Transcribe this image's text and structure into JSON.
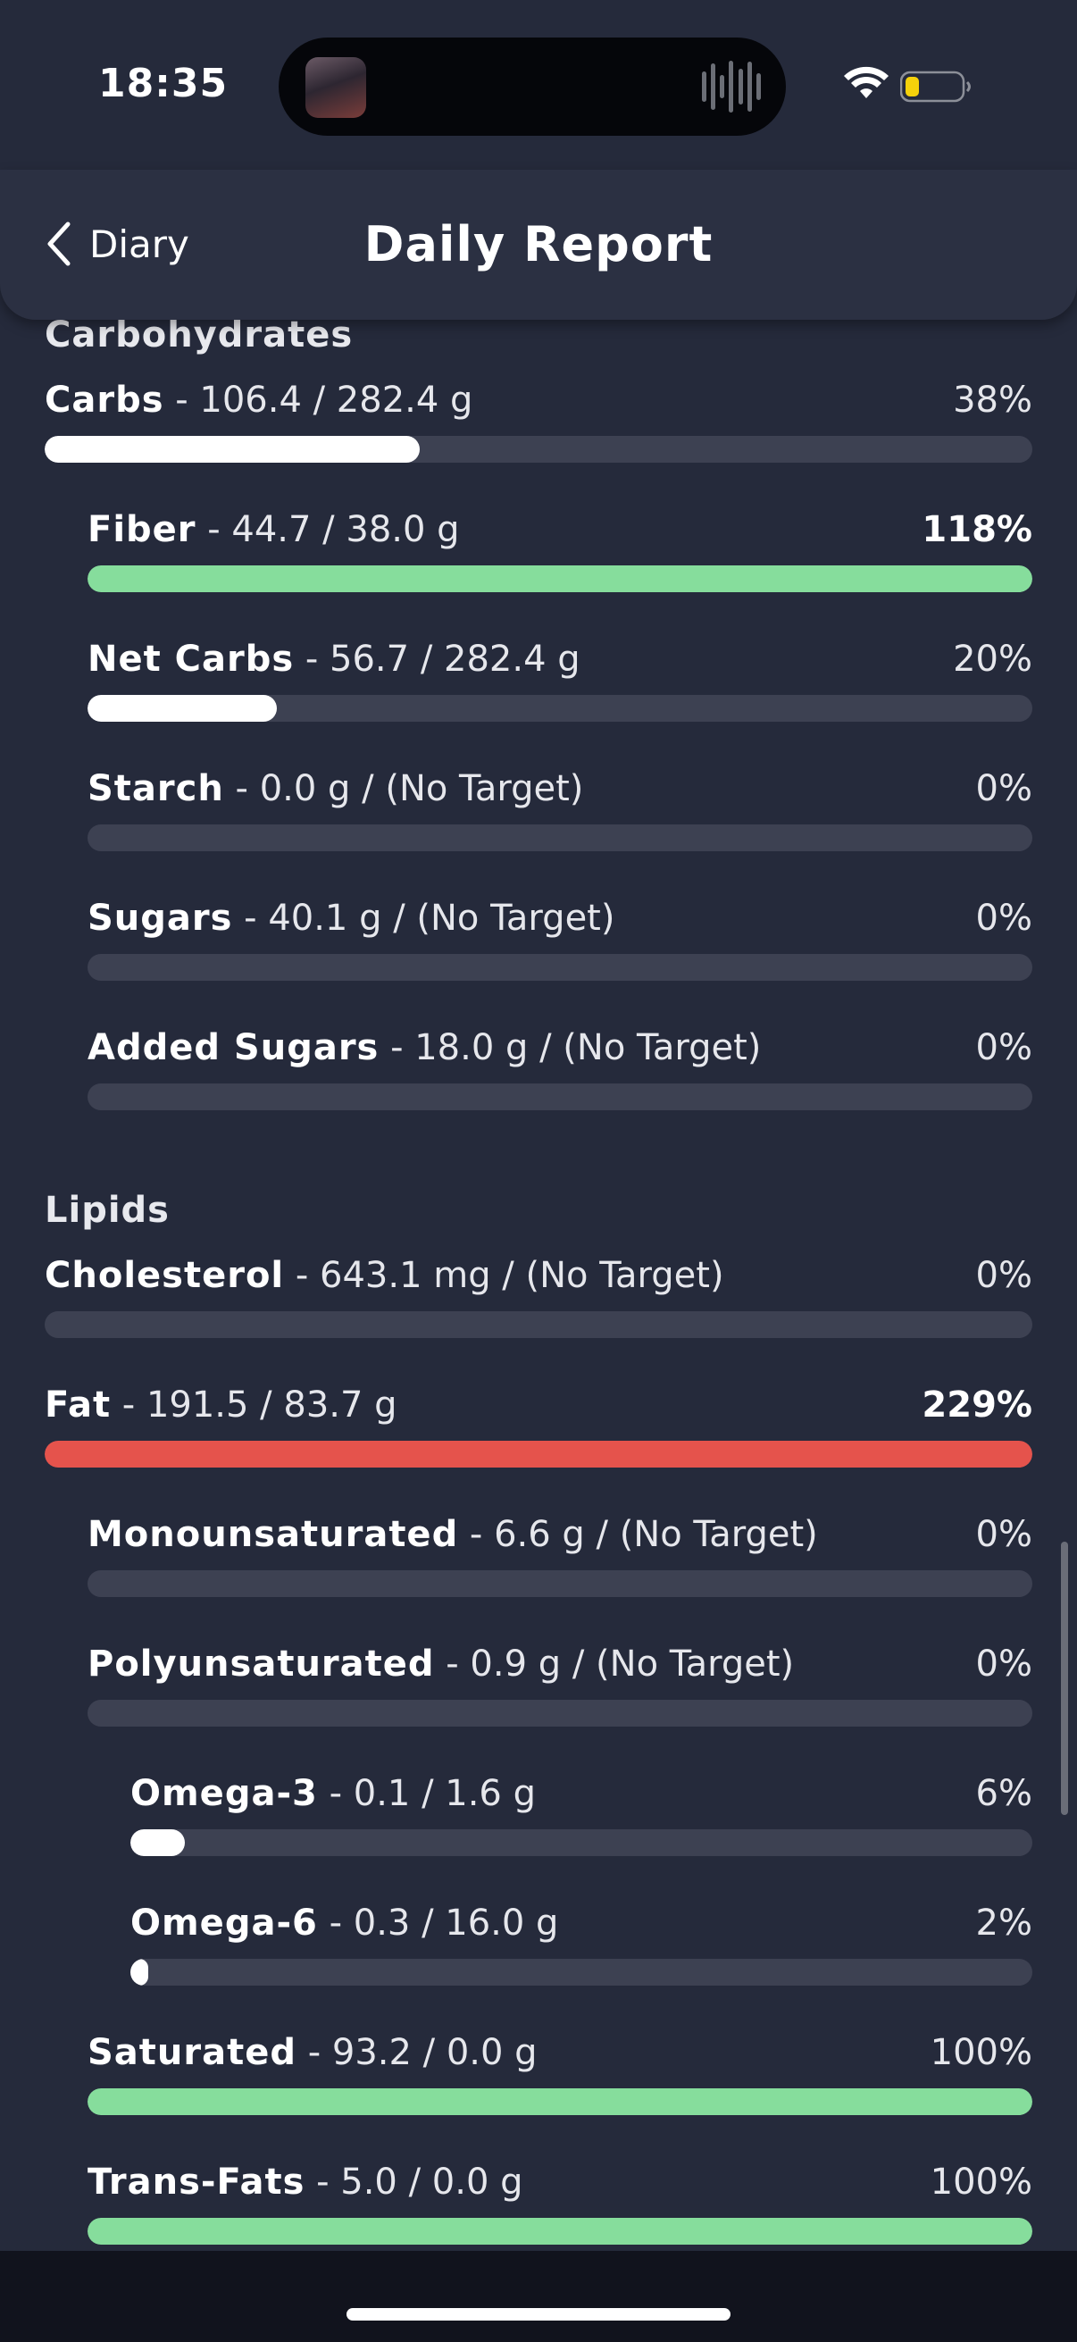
{
  "status_bar": {
    "time": "18:35",
    "battery_level": 0.25,
    "battery_color": "#f5d10b"
  },
  "header": {
    "back_label": "Diary",
    "title": "Daily Report"
  },
  "colors": {
    "background": "#252a3b",
    "track": "#3d4152",
    "fill_default": "#ffffff",
    "fill_good": "#86dd9c",
    "fill_over": "#e5534c"
  },
  "sections": [
    {
      "title": "Carbohydrates",
      "rows": [
        {
          "name": "Carbs",
          "detail": " - 106.4 / 282.4 g",
          "percent": "38%",
          "fill": 0.38,
          "status": "default",
          "level": 0,
          "bold_pct": false
        },
        {
          "name": "Fiber",
          "detail": " - 44.7 / 38.0 g",
          "percent": "118%",
          "fill": 1.0,
          "status": "good",
          "level": 1,
          "bold_pct": true
        },
        {
          "name": "Net Carbs",
          "detail": " - 56.7 / 282.4 g",
          "percent": "20%",
          "fill": 0.2,
          "status": "default",
          "level": 1,
          "bold_pct": false
        },
        {
          "name": "Starch",
          "detail": " - 0.0 g / (No Target)",
          "percent": "0%",
          "fill": 0,
          "status": "default",
          "level": 1,
          "bold_pct": false
        },
        {
          "name": "Sugars",
          "detail": " - 40.1 g / (No Target)",
          "percent": "0%",
          "fill": 0,
          "status": "default",
          "level": 1,
          "bold_pct": false
        },
        {
          "name": "Added Sugars",
          "detail": " - 18.0 g / (No Target)",
          "percent": "0%",
          "fill": 0,
          "status": "default",
          "level": 1,
          "bold_pct": false
        }
      ]
    },
    {
      "title": "Lipids",
      "rows": [
        {
          "name": "Cholesterol",
          "detail": " - 643.1 mg / (No Target)",
          "percent": "0%",
          "fill": 0,
          "status": "default",
          "level": 0,
          "bold_pct": false
        },
        {
          "name": "Fat",
          "detail": " - 191.5 / 83.7 g",
          "percent": "229%",
          "fill": 1.0,
          "status": "over",
          "level": 0,
          "bold_pct": true
        },
        {
          "name": "Monounsaturated",
          "detail": " - 6.6 g / (No Target)",
          "percent": "0%",
          "fill": 0,
          "status": "default",
          "level": 1,
          "bold_pct": false
        },
        {
          "name": "Polyunsaturated",
          "detail": " - 0.9 g / (No Target)",
          "percent": "0%",
          "fill": 0,
          "status": "default",
          "level": 1,
          "bold_pct": false
        },
        {
          "name": "Omega-3",
          "detail": " - 0.1 / 1.6 g",
          "percent": "6%",
          "fill": 0.06,
          "status": "default",
          "level": 2,
          "bold_pct": false
        },
        {
          "name": "Omega-6",
          "detail": " - 0.3 / 16.0 g",
          "percent": "2%",
          "fill": 0.02,
          "status": "default",
          "level": 2,
          "bold_pct": false
        },
        {
          "name": "Saturated",
          "detail": " - 93.2 / 0.0 g",
          "percent": "100%",
          "fill": 1.0,
          "status": "good",
          "level": 1,
          "bold_pct": false
        },
        {
          "name": "Trans-Fats",
          "detail": " - 5.0 / 0.0 g",
          "percent": "100%",
          "fill": 1.0,
          "status": "good",
          "level": 1,
          "bold_pct": false
        }
      ]
    }
  ]
}
